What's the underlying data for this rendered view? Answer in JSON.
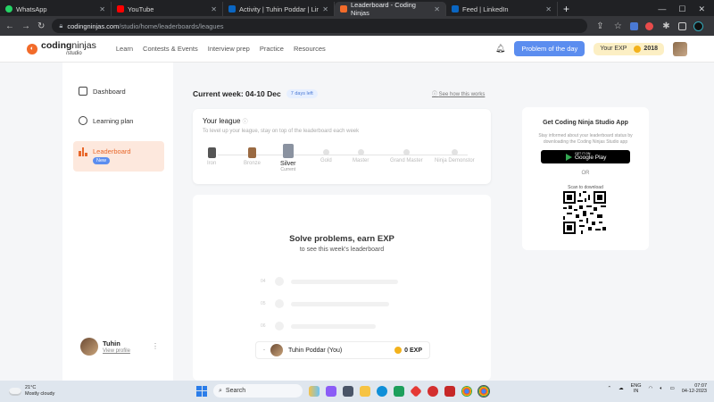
{
  "browser": {
    "tabs": [
      {
        "label": "WhatsApp",
        "color": "#25d366"
      },
      {
        "label": "YouTube",
        "color": "#ff0000"
      },
      {
        "label": "Activity | Tuhin Poddar | LinkedIn",
        "color": "#0a66c2"
      },
      {
        "label": "Leaderboard - Coding Ninjas",
        "color": "#f26b2a"
      },
      {
        "label": "Feed | LinkedIn",
        "color": "#0a66c2"
      }
    ],
    "url_domain": "codingninjas.com",
    "url_path": "/studio/home/leaderboards/leagues"
  },
  "header": {
    "logo_main_bold": "coding",
    "logo_main_rest": "ninjas",
    "logo_sub": "/studio",
    "nav": [
      "Learn",
      "Contests & Events",
      "Interview prep",
      "Practice",
      "Resources"
    ],
    "potd_label": "Problem of the day",
    "exp_label": "Your EXP",
    "exp_value": "2018"
  },
  "sidebar": {
    "items": [
      {
        "label": "Dashboard"
      },
      {
        "label": "Learning plan"
      },
      {
        "label": "Leaderboard",
        "badge": "New"
      }
    ],
    "profile_name": "Tuhin",
    "profile_link": "View profile"
  },
  "main": {
    "week_title": "Current week: 04-10 Dec",
    "days_left": "7 days left",
    "see_how": "See how this works",
    "league_title": "Your league",
    "league_sub": "To level up your league, stay on top of the leaderboard each week",
    "tiers": [
      {
        "name": "Iron"
      },
      {
        "name": "Bronze"
      },
      {
        "name": "Silver",
        "note": "Current"
      },
      {
        "name": "Gold"
      },
      {
        "name": "Master"
      },
      {
        "name": "Grand Master"
      },
      {
        "name": "Ninja Demonstor"
      }
    ],
    "solve_title": "Solve problems, earn EXP",
    "solve_sub": "to see this week's leaderboard",
    "skeleton_ranks": [
      "04",
      "05",
      "06"
    ],
    "you_row": {
      "rank": "-",
      "name": "Tuhin Poddar (You)",
      "exp": "0 EXP"
    }
  },
  "app_card": {
    "title": "Get Coding Ninja Studio App",
    "desc": "Stay informed about your leaderboard status by downloading the Coding Ninjas Studio app",
    "gplay_small": "GET IT ON",
    "gplay_big": "Google Play",
    "or": "OR",
    "scan": "Scan to download"
  },
  "taskbar": {
    "temp": "21°C",
    "weather": "Mostly cloudy",
    "search": "Search",
    "lang1": "ENG",
    "lang2": "IN",
    "time": "07:07",
    "date": "04-12-2023"
  }
}
